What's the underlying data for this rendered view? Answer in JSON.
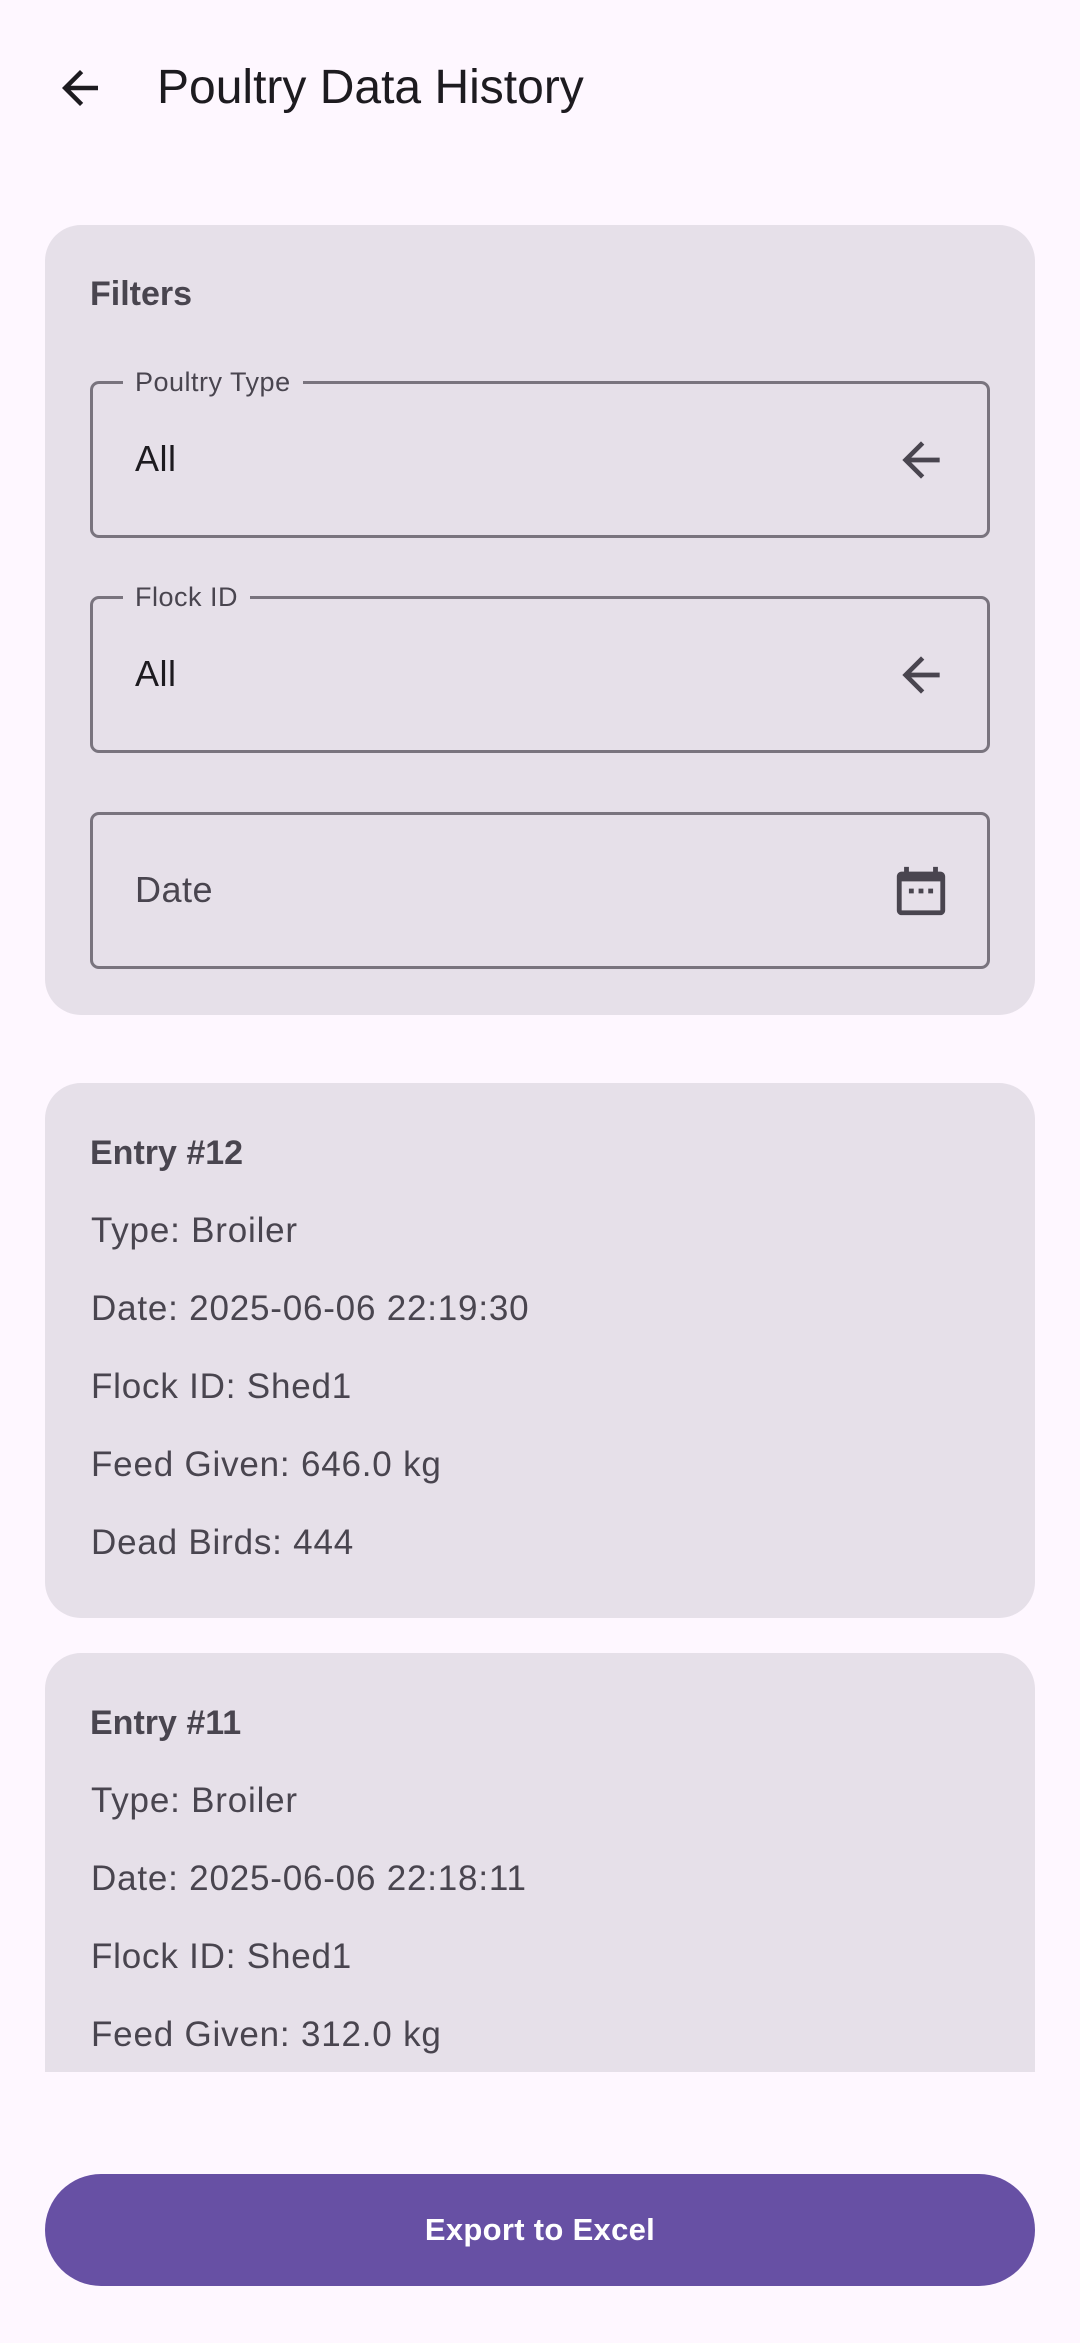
{
  "header": {
    "title": "Poultry Data History",
    "back_icon": "arrow-back-icon"
  },
  "filters": {
    "heading": "Filters",
    "poultry_type": {
      "label": "Poultry Type",
      "value": "All",
      "icon": "arrow-left-icon"
    },
    "flock_id": {
      "label": "Flock ID",
      "value": "All",
      "icon": "arrow-left-icon"
    },
    "date": {
      "placeholder": "Date",
      "icon": "calendar-icon"
    }
  },
  "entries": [
    {
      "title": "Entry #12",
      "type": "Type: Broiler",
      "date": "Date: 2025-06-06 22:19:30",
      "flock": "Flock ID: Shed1",
      "feed": "Feed Given: 646.0 kg",
      "dead": "Dead Birds: 444"
    },
    {
      "title": "Entry #11",
      "type": "Type: Broiler",
      "date": "Date: 2025-06-06 22:18:11",
      "flock": "Flock ID: Shed1",
      "feed": "Feed Given: 312.0 kg"
    }
  ],
  "actions": {
    "export_label": "Export to Excel"
  },
  "colors": {
    "primary": "#6750A4",
    "surface": "#FEF7FF",
    "card": "#E6E0E9",
    "outline": "#79747E",
    "text": "#1D1B20",
    "text_variant": "#49454F"
  }
}
